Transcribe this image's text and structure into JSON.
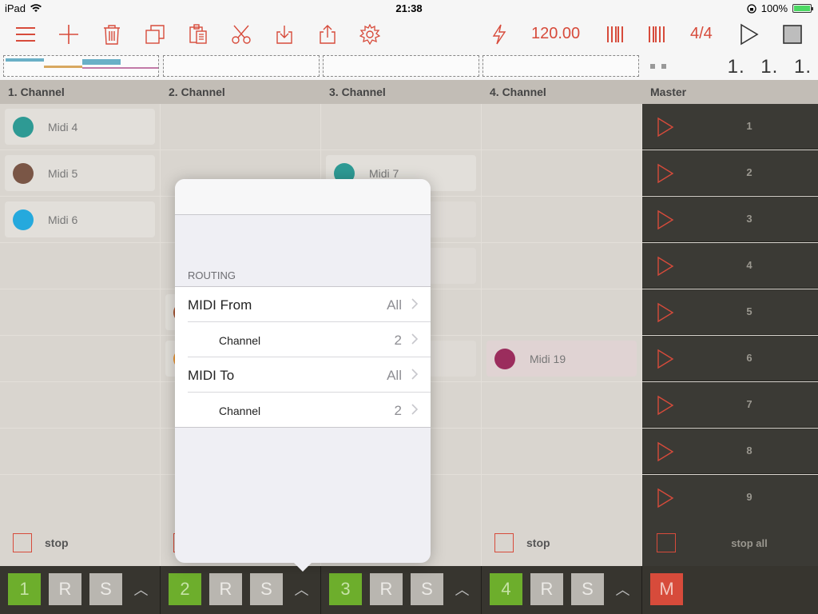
{
  "status_bar": {
    "device": "iPad",
    "time": "21:38",
    "battery": "100%"
  },
  "toolbar": {
    "tempo": "120.00",
    "time_signature": "4/4"
  },
  "position": {
    "bar": "1.",
    "beat": "1.",
    "tick": "1."
  },
  "channels": [
    {
      "header": "1. Channel",
      "stop_label": "stop",
      "number": "1"
    },
    {
      "header": "2. Channel",
      "stop_label": "stop",
      "number": "2"
    },
    {
      "header": "3. Channel",
      "stop_label": "stop",
      "number": "3"
    },
    {
      "header": "4. Channel",
      "stop_label": "stop",
      "number": "4"
    }
  ],
  "clips": {
    "c1_r1": {
      "name": "Midi 4",
      "color": "#2e9a94"
    },
    "c1_r2": {
      "name": "Midi 5",
      "color": "#7a5646"
    },
    "c1_r3": {
      "name": "Midi 6",
      "color": "#25a9dd"
    },
    "c3_r2": {
      "name": "Midi 7",
      "color": "#2e9a94"
    },
    "c4_r6": {
      "name": "Midi 19",
      "color": "#9b2d5d"
    }
  },
  "master": {
    "header": "Master",
    "scenes": [
      "1",
      "2",
      "3",
      "4",
      "5",
      "6",
      "7",
      "8",
      "9"
    ],
    "stop_label": "stop all",
    "mute_label": "M"
  },
  "bottom_bar": {
    "record_label": "R",
    "solo_label": "S"
  },
  "popover": {
    "section_title": "ROUTING",
    "rows": [
      {
        "label": "MIDI From",
        "value": "All"
      },
      {
        "label": "Channel",
        "value": "2"
      },
      {
        "label": "MIDI To",
        "value": "All"
      },
      {
        "label": "Channel",
        "value": "2"
      }
    ]
  },
  "colors": {
    "accent": "#d74b3b",
    "green": "#6dae2c",
    "master_bg": "#3b3a35"
  }
}
